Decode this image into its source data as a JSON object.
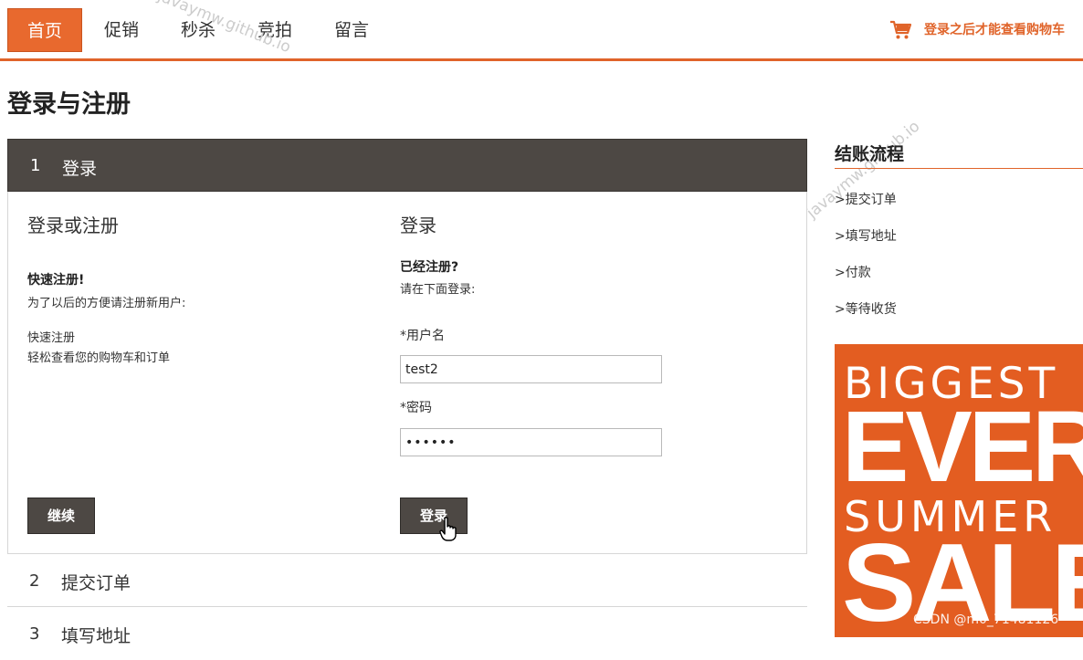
{
  "nav": {
    "items": [
      {
        "label": "首页",
        "active": true
      },
      {
        "label": "促销",
        "active": false
      },
      {
        "label": "秒杀",
        "active": false
      },
      {
        "label": "竞拍",
        "active": false
      },
      {
        "label": "留言",
        "active": false
      }
    ],
    "cart_text": "登录之后才能查看购物车",
    "cart_icon": "shopping-cart-icon"
  },
  "watermarks": [
    "javaymw.github.io"
  ],
  "page_title": "登录与注册",
  "steps": [
    {
      "num": "1",
      "label": "登录",
      "active": true
    },
    {
      "num": "2",
      "label": "提交订单",
      "active": false
    },
    {
      "num": "3",
      "label": "填写地址",
      "active": false
    }
  ],
  "register": {
    "title": "登录或注册",
    "quick_heading": "快速注册!",
    "quick_desc": "为了以后的方便请注册新用户:",
    "line1": "快速注册",
    "line2": "轻松查看您的购物车和订单",
    "continue_label": "继续"
  },
  "login": {
    "title": "登录",
    "heading": "已经注册?",
    "desc": "请在下面登录:",
    "username_label": "*用户名",
    "username_value": "test2",
    "password_label": "*密码",
    "password_value": "••••••",
    "submit_label": "登录"
  },
  "sidebar": {
    "title": "结账流程",
    "items": [
      ">提交订单",
      ">填写地址",
      ">付款",
      ">等待收货"
    ]
  },
  "banner": {
    "line1": "BIGGEST",
    "line2": "EVER",
    "line3": "SUMMER",
    "line4": "SALE"
  },
  "credit": "CSDN @m0_71481126",
  "colors": {
    "accent": "#e0642a",
    "dark": "#4d4844",
    "banner": "#e35d21"
  }
}
